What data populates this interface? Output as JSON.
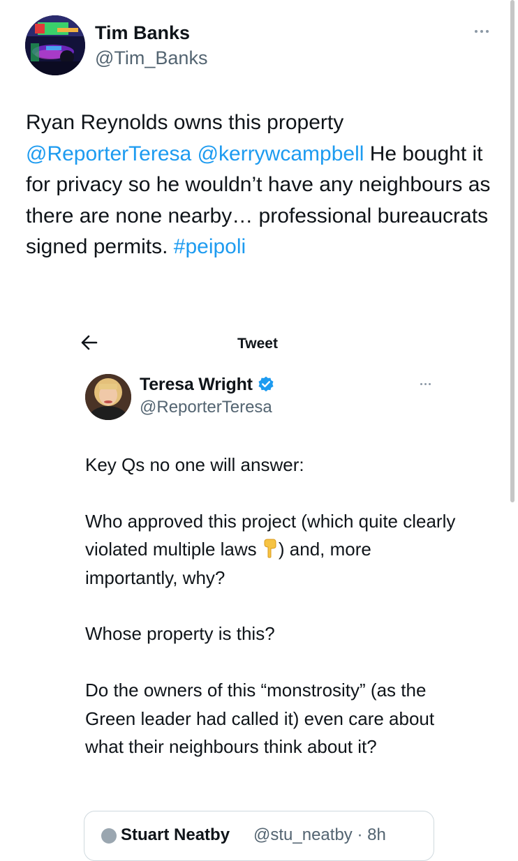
{
  "author": {
    "display_name": "Tim Banks",
    "handle": "@Tim_Banks"
  },
  "tweet": {
    "text_1": "Ryan Reynolds owns this property ",
    "mention_1": "@ReporterTeresa",
    "mention_2": "@kerrywcampbell",
    "text_2": " He bought it for privacy so he wouldn’t have any neighbours as there are none nearby… professional bureaucrats signed permits. ",
    "hashtag": "#peipoli"
  },
  "embedded": {
    "header_title": "Tweet",
    "author": {
      "display_name": "Teresa Wright",
      "handle": "@ReporterTeresa",
      "verified": true
    },
    "paragraph_1": "Key Qs no one will answer:",
    "paragraph_2_a": "Who approved this project (which quite clearly violated multiple laws ",
    "paragraph_2_b": ") and, more importantly, why?",
    "paragraph_3": "Whose property is this?",
    "paragraph_4": "Do the owners of this “monstrosity” (as the Green leader had called it) even care about what their neighbours think about it?",
    "quoted": {
      "name": "Stuart Neatby",
      "meta": "@stu_neatby · 8h"
    }
  },
  "icons": {
    "more_outer": "more-horizontal-icon",
    "back": "arrow-left-icon",
    "verified": "verified-badge-icon",
    "more_inner": "more-horizontal-icon",
    "emoji": "backhand-index-pointing-down-icon"
  },
  "colors": {
    "link": "#1d9bf0",
    "text": "#0f1419",
    "secondary": "#536471",
    "border": "#cfd9de"
  }
}
